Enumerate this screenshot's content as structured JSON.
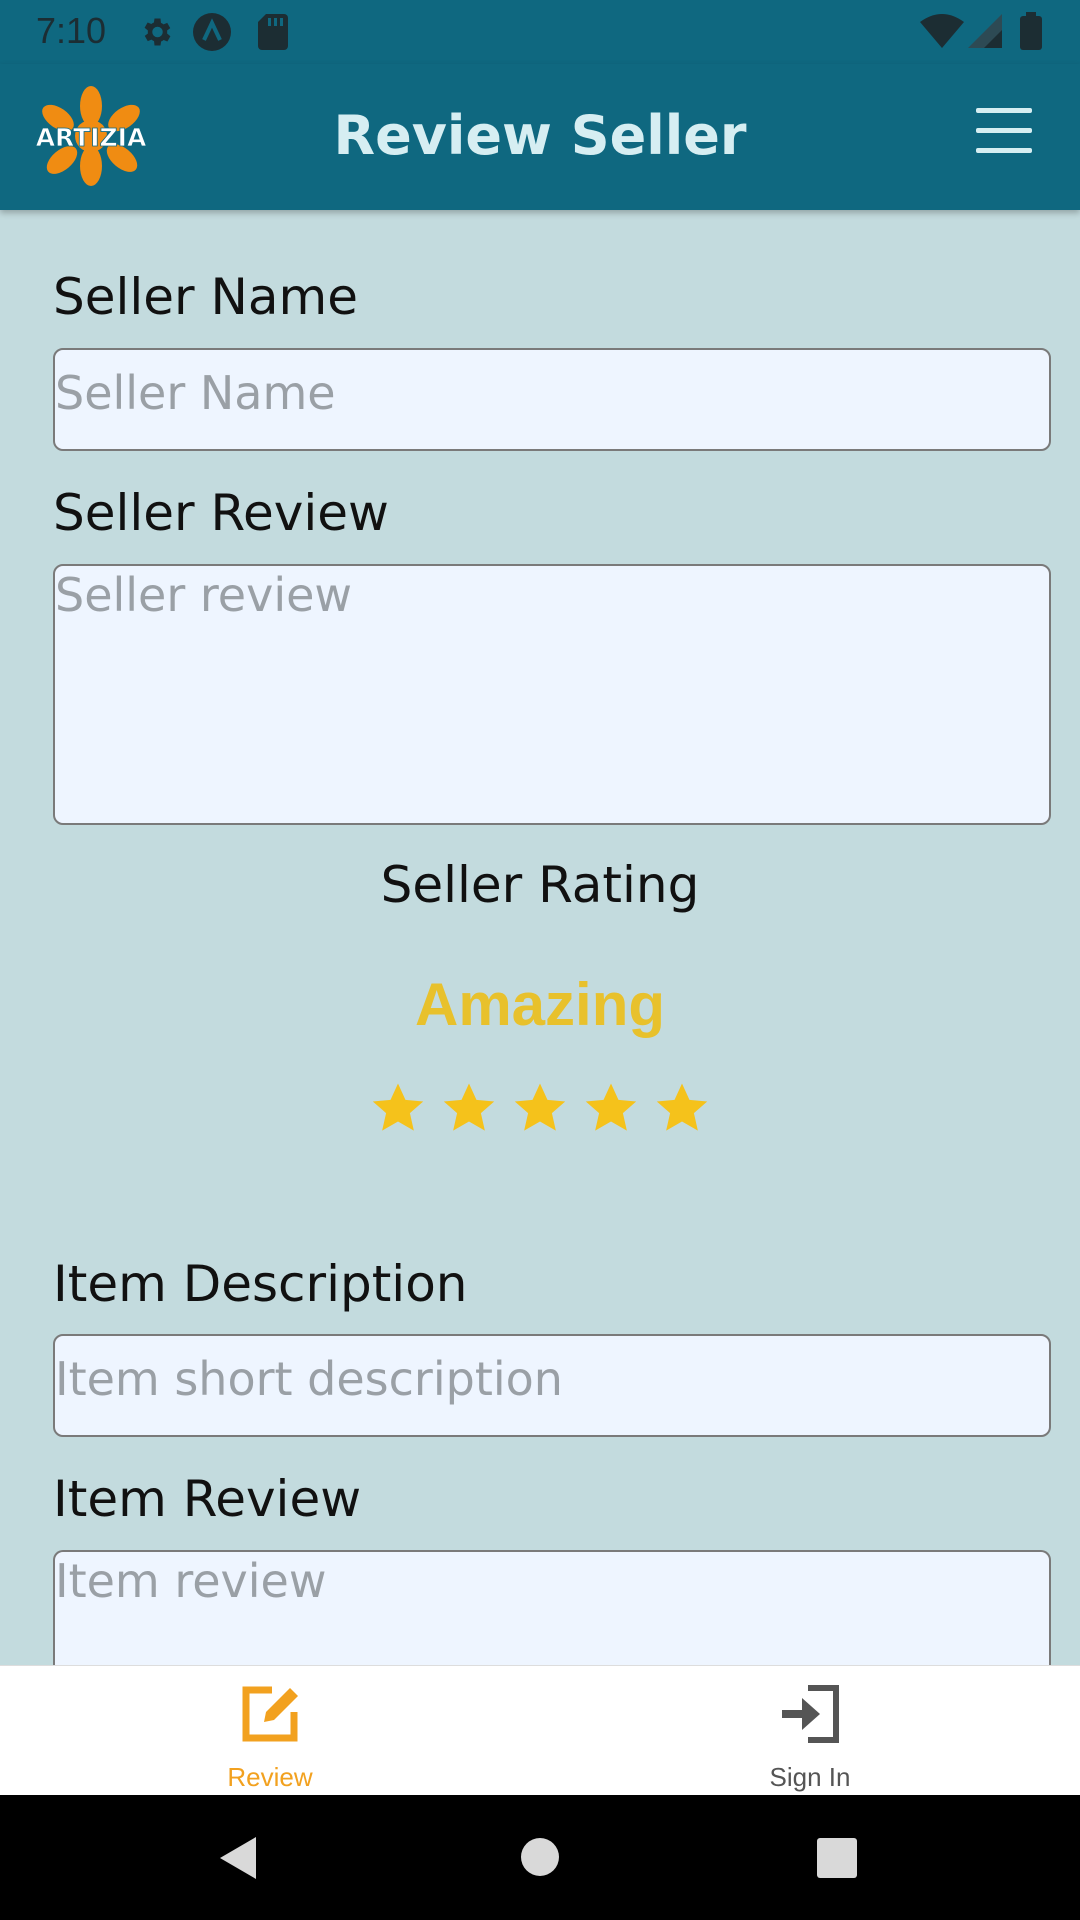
{
  "status_bar": {
    "time": "7:10",
    "left_icons": [
      "settings-icon",
      "a-icon",
      "sd-card-icon"
    ],
    "right_icons": [
      "wifi-icon",
      "signal-icon",
      "battery-icon"
    ]
  },
  "app_bar": {
    "logo_text": "ARTIZIA",
    "title": "Review Seller",
    "menu_icon": "hamburger-menu-icon"
  },
  "form": {
    "seller_name": {
      "label": "Seller Name",
      "placeholder": "Seller Name",
      "value": ""
    },
    "seller_review": {
      "label": "Seller Review",
      "placeholder": "Seller review",
      "value": ""
    },
    "seller_rating": {
      "label": "Seller Rating",
      "rating_text": "Amazing",
      "stars": 5,
      "max_stars": 5
    },
    "item_description": {
      "label": "Item Description",
      "placeholder": "Item short description",
      "value": ""
    },
    "item_review": {
      "label": "Item Review",
      "placeholder": "Item review",
      "value": ""
    }
  },
  "bottom_nav": {
    "items": [
      {
        "label": "Review",
        "icon": "edit-icon",
        "active": true
      },
      {
        "label": "Sign In",
        "icon": "sign-in-icon",
        "active": false
      }
    ]
  },
  "colors": {
    "app_bar": "#0f6880",
    "background": "#c3dbde",
    "accent": "#f2a11f",
    "star": "#f5c21b",
    "rating_text": "#e8c12c"
  }
}
